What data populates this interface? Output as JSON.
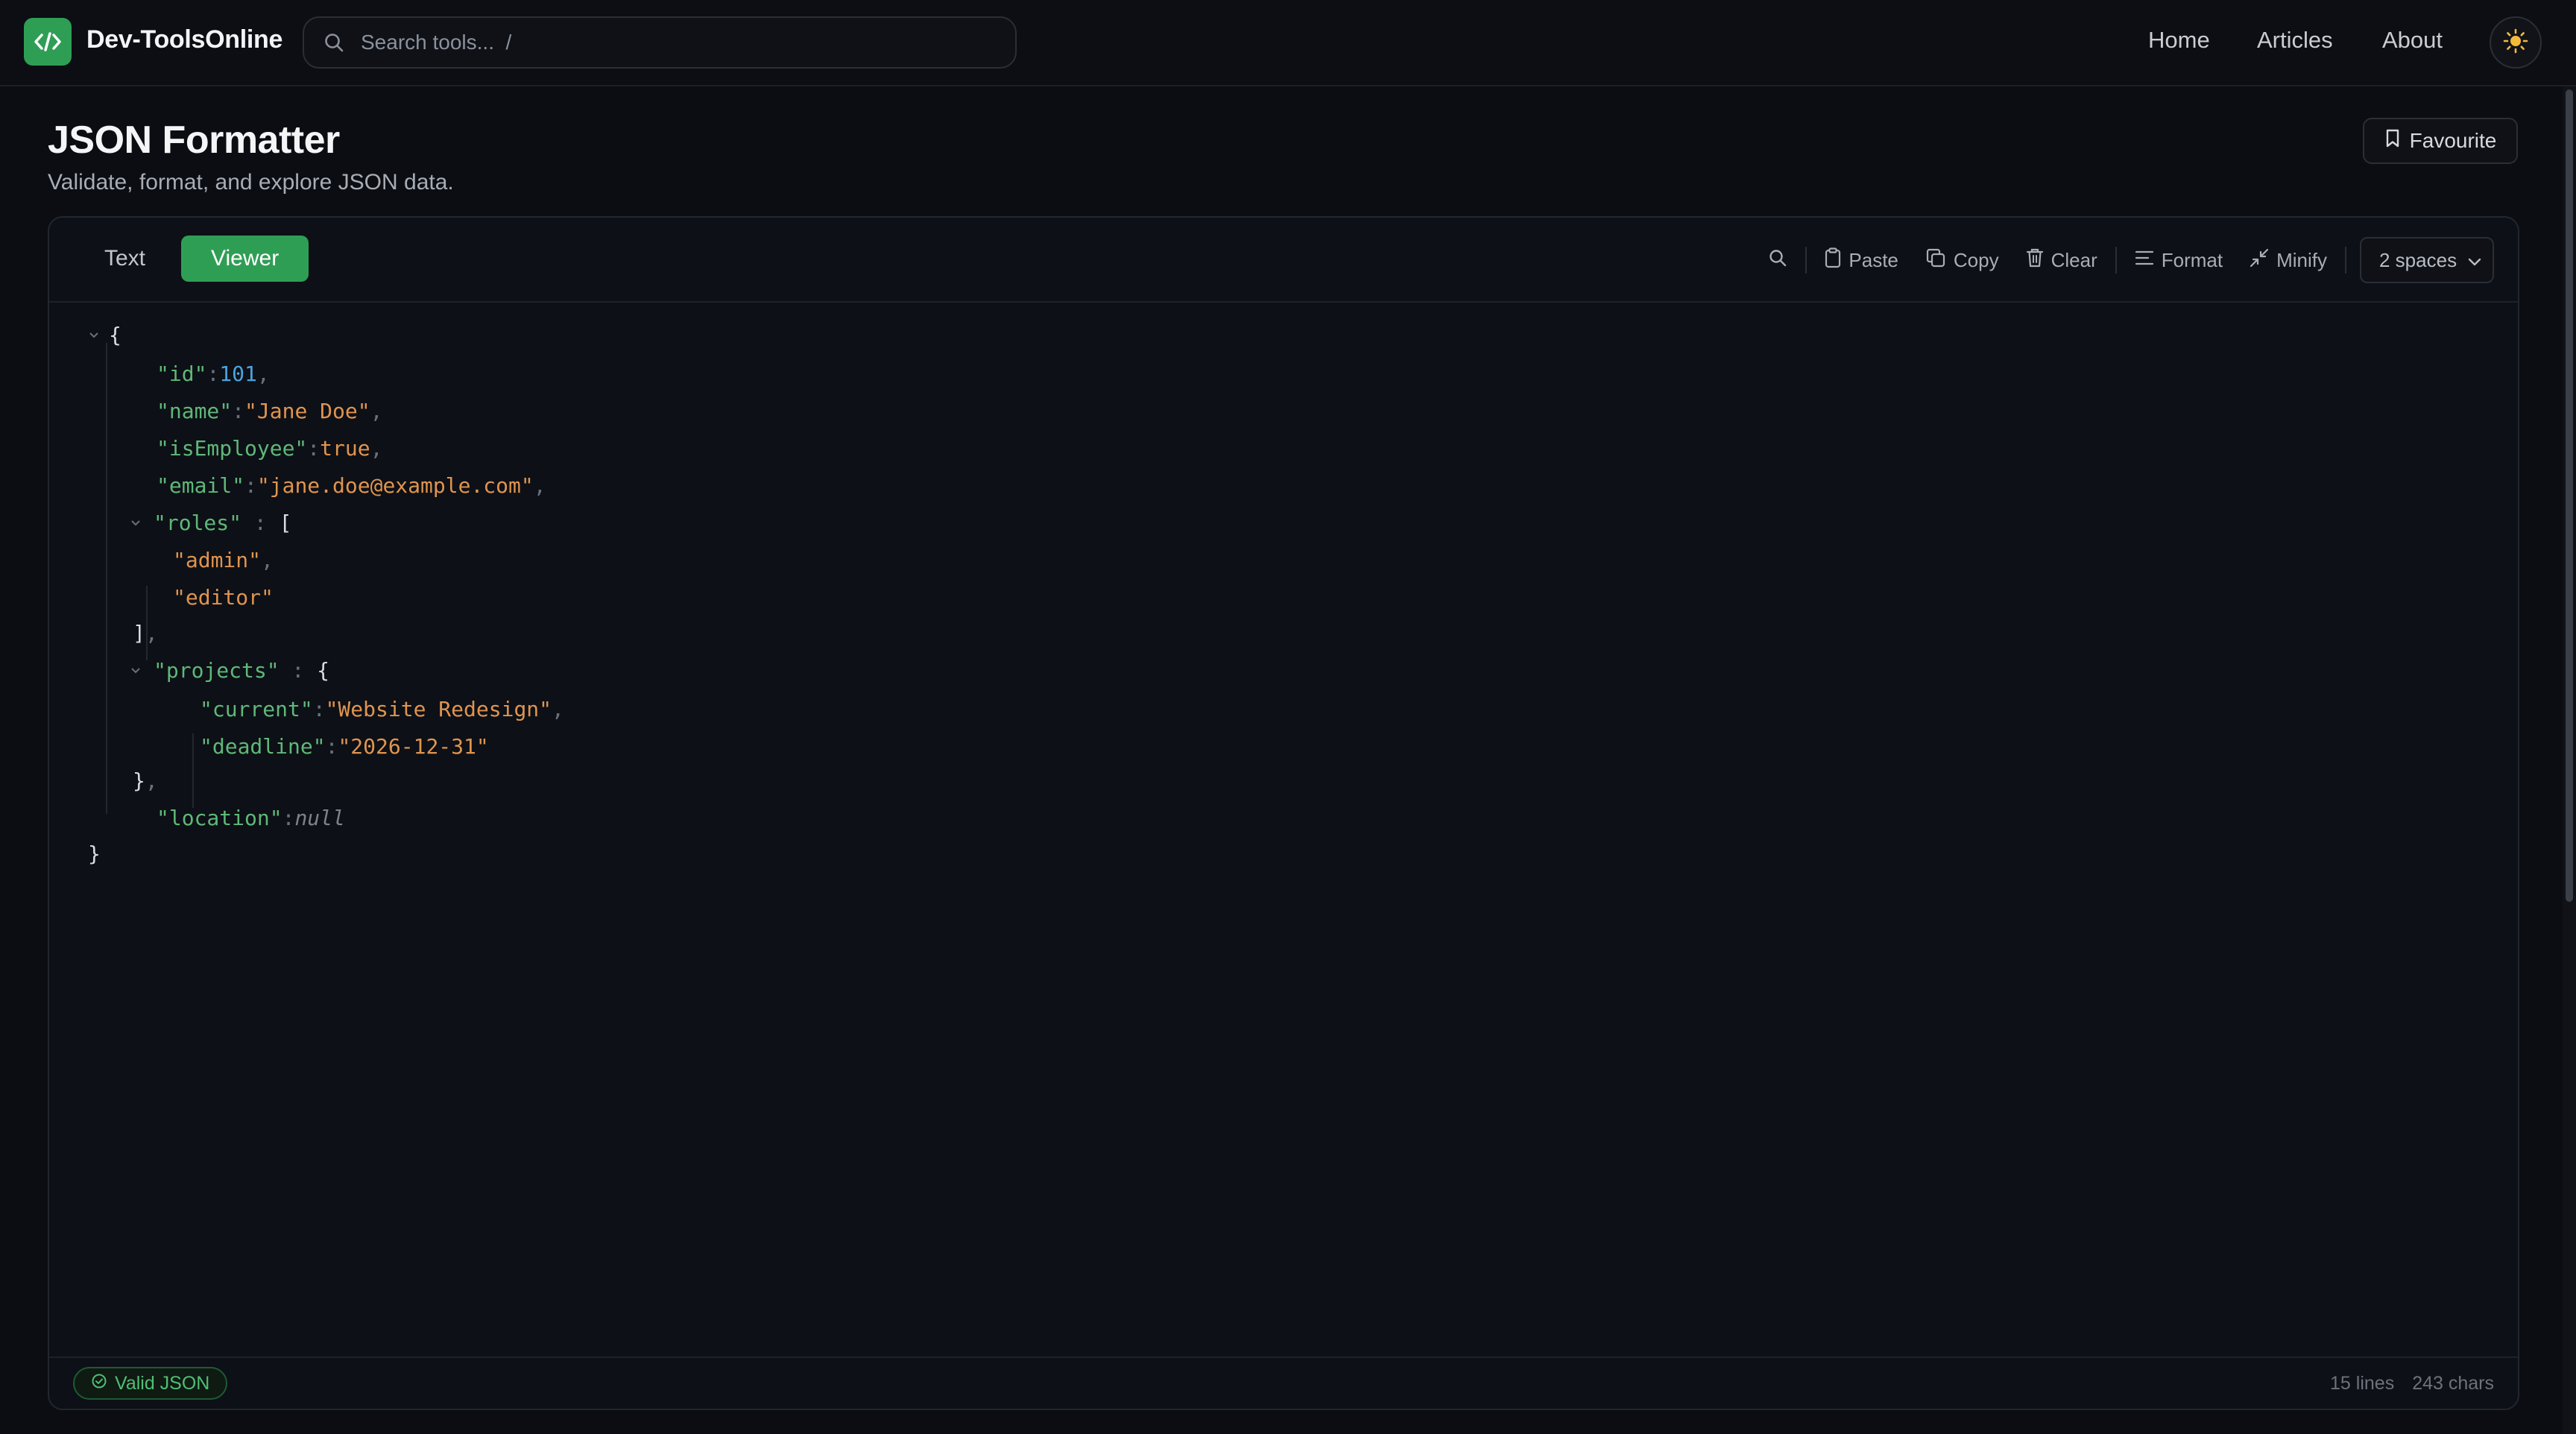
{
  "header": {
    "brand": "Dev-ToolsOnline",
    "search_placeholder": "Search tools...  /",
    "nav": [
      "Home",
      "Articles",
      "About"
    ],
    "theme_icon": "sun-icon"
  },
  "page": {
    "title": "JSON Formatter",
    "subtitle": "Validate, format, and explore JSON data.",
    "favourite_label": "Favourite"
  },
  "tabs": {
    "text": "Text",
    "viewer": "Viewer",
    "active": "Viewer"
  },
  "toolbar": {
    "paste": "Paste",
    "copy": "Copy",
    "clear": "Clear",
    "format": "Format",
    "minify": "Minify",
    "indent_selected": "2 spaces"
  },
  "json": {
    "open_brace": "{",
    "close_brace": "}",
    "id_key": "\"id\"",
    "id_val": "101",
    "name_key": "\"name\"",
    "name_val": "\"Jane Doe\"",
    "emp_key": "\"isEmployee\"",
    "emp_val": "true",
    "email_key": "\"email\"",
    "email_val": "\"jane.doe@example.com\"",
    "roles_key": "\"roles\"",
    "roles_open": "[",
    "role_0": "\"admin\"",
    "role_1": "\"editor\"",
    "roles_close": "]",
    "projects_key": "\"projects\"",
    "projects_open": "{",
    "current_key": "\"current\"",
    "current_val": "\"Website Redesign\"",
    "deadline_key": "\"deadline\"",
    "deadline_val": "\"2026-12-31\"",
    "projects_close": "}",
    "location_key": "\"location\"",
    "location_val": "null",
    "colon": ":",
    "comma": ","
  },
  "status": {
    "valid": "Valid JSON",
    "lines": "15 lines",
    "chars": "243 chars"
  },
  "colors": {
    "accent": "#2f9e55",
    "key": "#5fb878",
    "string": "#e0944f",
    "number": "#4aa3df"
  }
}
